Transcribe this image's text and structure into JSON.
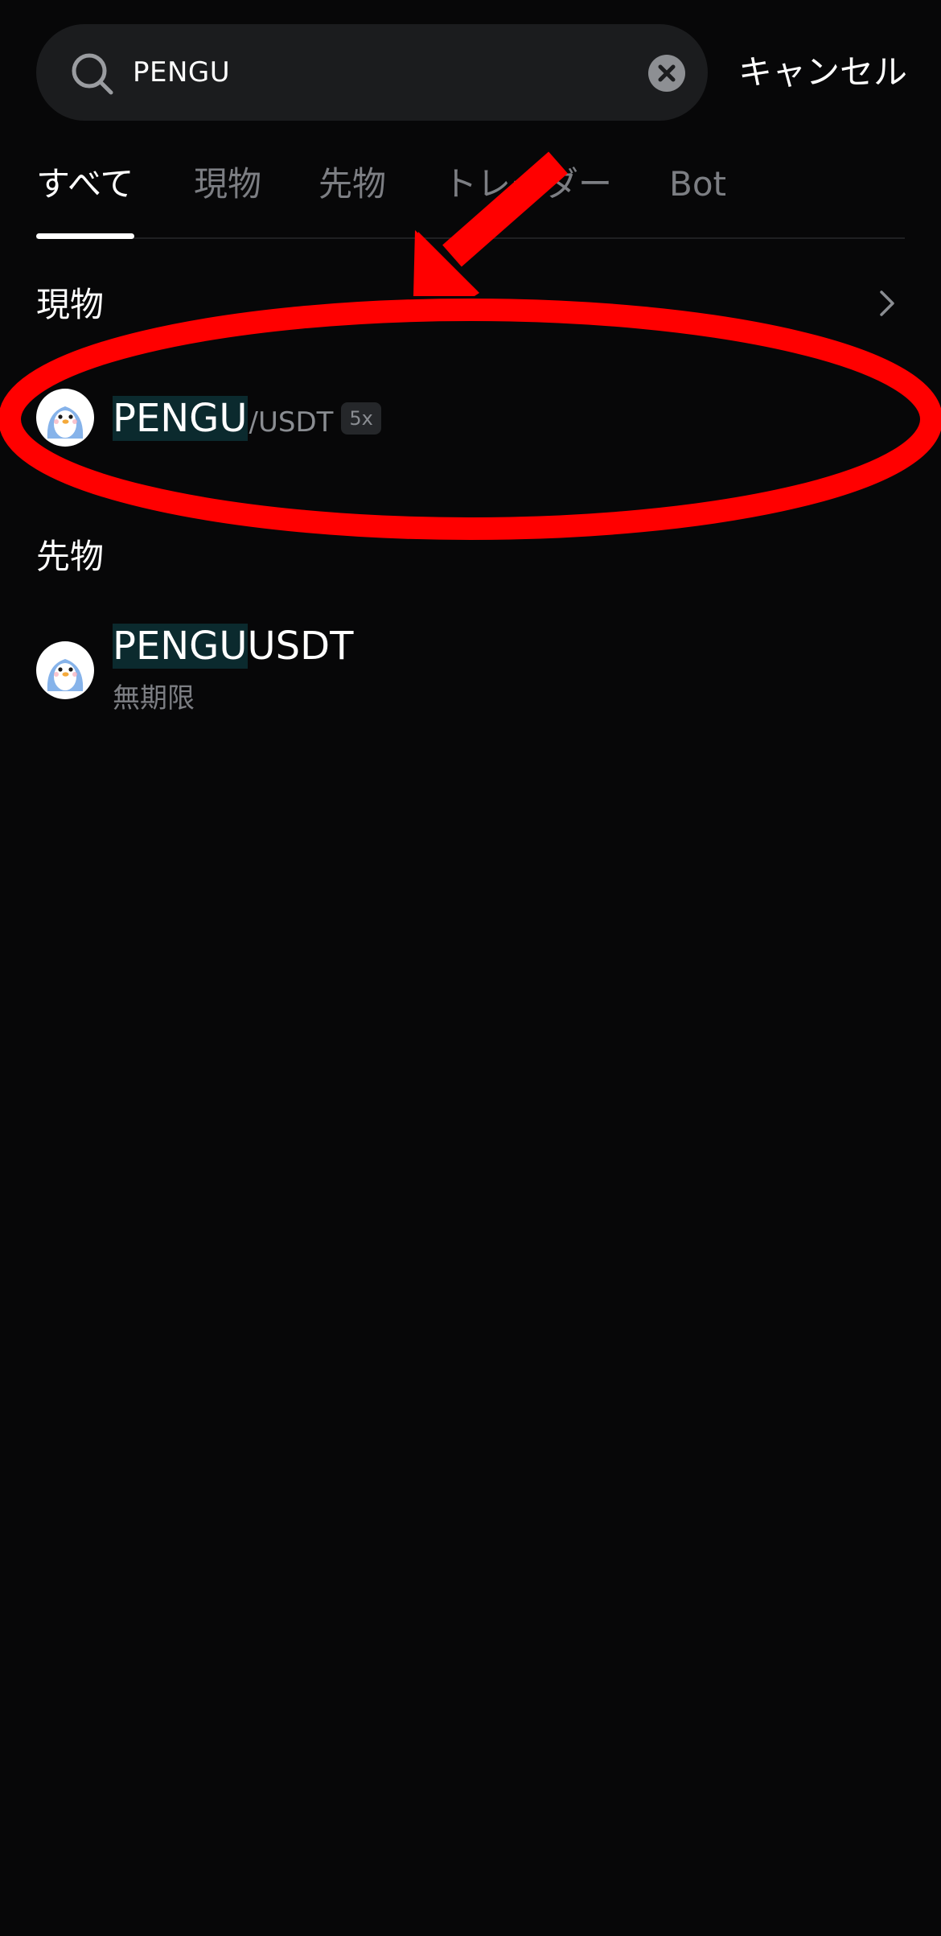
{
  "search": {
    "query": "PENGU",
    "cancel_label": "キャンセル"
  },
  "tabs": [
    {
      "label": "すべて",
      "active": true
    },
    {
      "label": "現物",
      "active": false
    },
    {
      "label": "先物",
      "active": false
    },
    {
      "label": "トレーダー",
      "active": false
    },
    {
      "label": "Bot",
      "active": false
    }
  ],
  "sections": {
    "spot": {
      "title": "現物",
      "item": {
        "base_highlight": "PENGU",
        "quote": "/USDT",
        "leverage": "5x",
        "icon": "pengu-avatar"
      }
    },
    "futures": {
      "title": "先物",
      "item": {
        "base_highlight": "PENGU",
        "suffix": "USDT",
        "subtitle": "無期限",
        "icon": "pengu-avatar"
      }
    }
  },
  "colors": {
    "background": "#070708",
    "search_box": "#1b1c1e",
    "highlight": "#0b2a2e",
    "muted_text": "#7c7e83",
    "annotation_red": "#ff0000"
  }
}
